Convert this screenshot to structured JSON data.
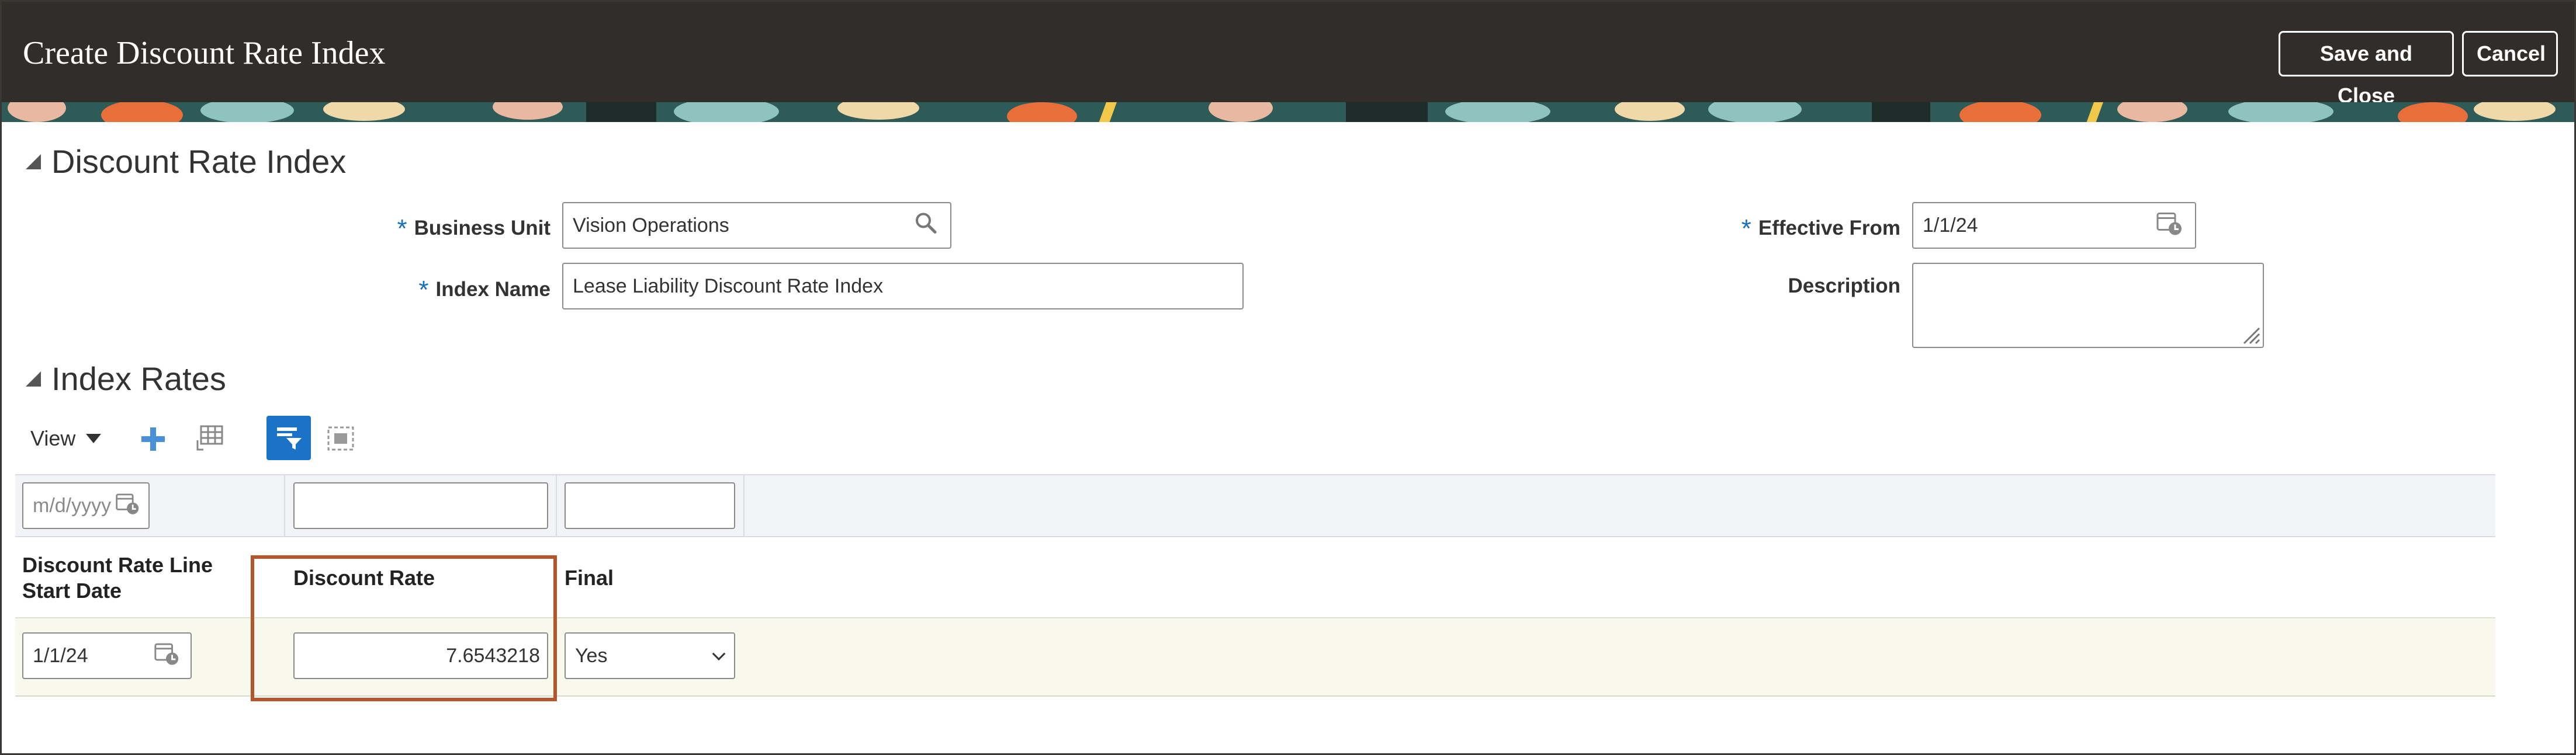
{
  "header": {
    "title": "Create Discount Rate Index",
    "save_close_label": "Save and Close",
    "cancel_label": "Cancel"
  },
  "section_index": {
    "title": "Discount Rate Index",
    "business_unit": {
      "label": "Business Unit",
      "value": "Vision Operations",
      "required": "*"
    },
    "index_name": {
      "label": "Index Name",
      "value": "Lease Liability Discount Rate Index",
      "required": "*"
    },
    "effective_from": {
      "label": "Effective From",
      "value": "1/1/24",
      "required": "*"
    },
    "description": {
      "label": "Description",
      "value": ""
    }
  },
  "section_rates": {
    "title": "Index Rates",
    "toolbar": {
      "view_label": "View"
    },
    "filters": {
      "start_date_placeholder": "m/d/yyyy",
      "discount_rate": "",
      "final": ""
    },
    "columns": {
      "start_date_line1": "Discount Rate Line",
      "start_date_line2": "Start Date",
      "discount_rate": "Discount Rate",
      "final": "Final"
    },
    "rows": [
      {
        "start_date": "1/1/24",
        "discount_rate": "7.6543218",
        "final": "Yes"
      }
    ]
  },
  "colors": {
    "header_bg": "#312d2a",
    "accent_blue": "#1a73c7",
    "highlight_border": "#b4552c"
  },
  "icons": {
    "business_unit_search": "search-icon",
    "effective_from_calendar": "calendar-icon",
    "add": "plus-icon",
    "freeze": "freeze-columns-icon",
    "query_by_example": "filter-icon",
    "detach": "detach-icon"
  }
}
